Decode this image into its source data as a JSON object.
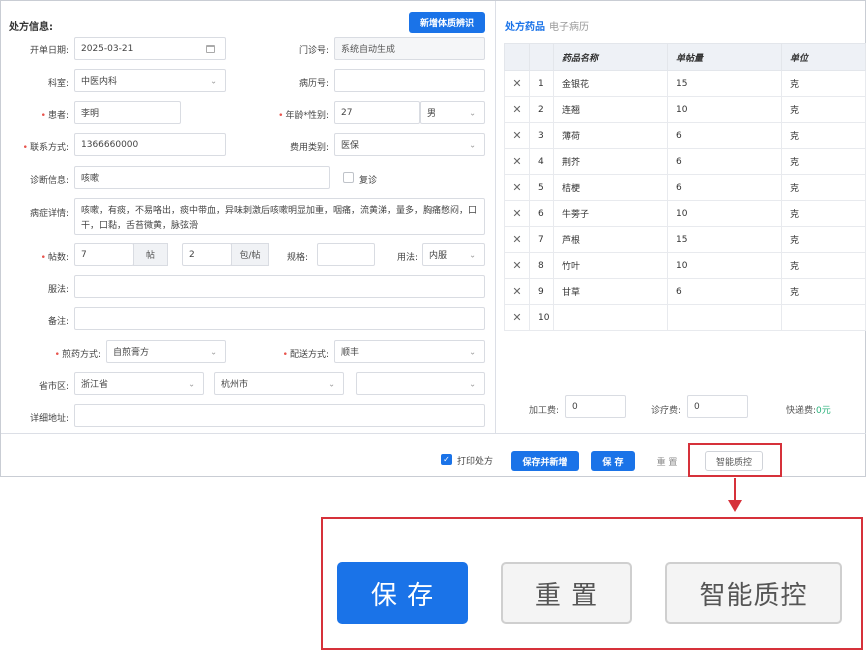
{
  "form": {
    "section_title": "处方信息:",
    "new_btn": "新增体质辨识",
    "date_label": "开单日期:",
    "date_value": "2025-03-21",
    "clinic_no_label": "门诊号:",
    "clinic_no_value": "系统自动生成",
    "dept_label": "科室:",
    "dept_value": "中医内科",
    "record_no_label": "病历号:",
    "record_no_value": "",
    "patient_label": "患者:",
    "patient_value": "李明",
    "age_sex_label": "年龄*性别:",
    "age_value": "27",
    "sex_value": "男",
    "contact_label": "联系方式:",
    "contact_value": "1366660000",
    "fee_type_label": "费用类别:",
    "fee_type_value": "医保",
    "diag_label": "诊断信息:",
    "diag_value": "咳嗽",
    "revisit_label": "复诊",
    "symptom_label": "病症详情:",
    "symptom_value": "咳嗽，有痰，不易咯出，痰中带血，异味刺激后咳嗽明显加重，咽痛，流黄涕，量多，胸痛憋闷，口干，口黏，舌苔微黄，脉弦滑",
    "dose_label": "帖数:",
    "dose_value": "7",
    "dose_unit": "帖",
    "pack_value": "2",
    "pack_unit": "包/帖",
    "spec_label": "规格:",
    "spec_value": "",
    "usage_label": "用法:",
    "usage_value": "内服",
    "take_label": "服法:",
    "take_value": "",
    "note_label": "备注:",
    "note_value": "",
    "decoct_label": "煎药方式:",
    "decoct_value": "自煎膏方",
    "delivery_label": "配送方式:",
    "delivery_value": "顺丰",
    "region_label": "省市区:",
    "province_value": "浙江省",
    "city_value": "杭州市",
    "district_value": "",
    "address_label": "详细地址:",
    "address_value": ""
  },
  "rx": {
    "tab_active": "处方药品",
    "tab_inactive": "电子病历",
    "headers": [
      "药品名称",
      "单帖量",
      "单位"
    ],
    "rows": [
      {
        "n": "1",
        "name": "金银花",
        "dose": "15",
        "unit": "克"
      },
      {
        "n": "2",
        "name": "连翘",
        "dose": "10",
        "unit": "克"
      },
      {
        "n": "3",
        "name": "薄荷",
        "dose": "6",
        "unit": "克"
      },
      {
        "n": "4",
        "name": "荆芥",
        "dose": "6",
        "unit": "克"
      },
      {
        "n": "5",
        "name": "桔梗",
        "dose": "6",
        "unit": "克"
      },
      {
        "n": "6",
        "name": "牛蒡子",
        "dose": "10",
        "unit": "克"
      },
      {
        "n": "7",
        "name": "芦根",
        "dose": "15",
        "unit": "克"
      },
      {
        "n": "8",
        "name": "竹叶",
        "dose": "10",
        "unit": "克"
      },
      {
        "n": "9",
        "name": "甘草",
        "dose": "6",
        "unit": "克"
      },
      {
        "n": "10",
        "name": "",
        "dose": "",
        "unit": ""
      }
    ],
    "process_fee_label": "加工费:",
    "process_fee_value": "0",
    "consult_fee_label": "诊疗费:",
    "consult_fee_value": "0",
    "express_fee_label": "快递费:",
    "express_fee_value": "0元"
  },
  "footer": {
    "print_label": "打印处方",
    "save_new": "保存并新增",
    "save": "保 存",
    "reset": "重 置",
    "qc": "智能质控"
  },
  "callout": {
    "save": "保 存",
    "reset": "重 置",
    "qc": "智能质控"
  },
  "colors": {
    "primary": "#1a73e8",
    "highlight": "#d6313a"
  }
}
